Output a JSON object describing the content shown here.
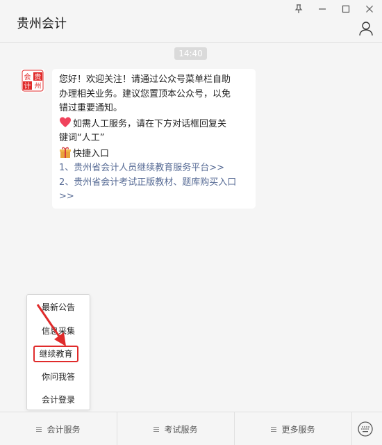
{
  "header": {
    "title": "贵州会计",
    "controls": [
      "pin-icon",
      "minimize-icon",
      "maximize-icon",
      "close-icon"
    ],
    "profile_icon": "person-icon"
  },
  "chat": {
    "timestamp": "14:40",
    "avatar": {
      "top": "会贵",
      "bottom": "计州",
      "color": "#e02b2b"
    },
    "message": {
      "line1": "您好！欢迎关注！请通过公众号菜单栏自助",
      "line2": "办理相关业务。建议您置顶本公众号，以免",
      "line3": "错过重要通知。",
      "line4": "如需人工服务，请在下方对话框回复关",
      "line5": "键词“人工”",
      "line6": "快捷入口",
      "link1": "1、贵州省会计人员继续教育服务平台>>",
      "link2a": "2、贵州省会计考试正版教材、题库购买入口",
      "link2b": ">>"
    }
  },
  "menu": {
    "items": [
      "最新公告",
      "信息采集",
      "继续教育",
      "你问我答",
      "会计登录"
    ],
    "highlighted": "继续教育",
    "highlight_color": "#e02b2b"
  },
  "tabbar": {
    "tabs": [
      "会计服务",
      "考试服务",
      "更多服务"
    ],
    "keyboard_icon": "keyboard-icon"
  }
}
